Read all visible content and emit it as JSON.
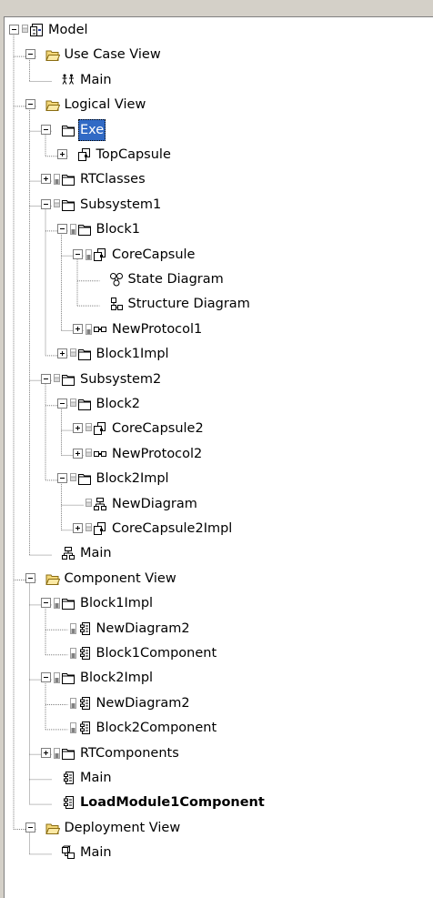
{
  "tree": [
    {
      "label": "Model",
      "level": 0,
      "icon": "model-icon",
      "control": "half",
      "state": "expanded"
    },
    {
      "label": "Use Case View",
      "level": 1,
      "icon": "folder-open-icon",
      "state": "expanded"
    },
    {
      "label": "Main",
      "level": 2,
      "icon": "use-case-diagram-icon",
      "state": "leaf"
    },
    {
      "label": "Logical View",
      "level": 1,
      "icon": "folder-open-icon",
      "state": "expanded"
    },
    {
      "label": "Exe",
      "level": 2,
      "icon": "package-icon",
      "state": "expanded",
      "selected": true
    },
    {
      "label": "TopCapsule",
      "level": 3,
      "icon": "capsule-icon",
      "state": "collapsed"
    },
    {
      "label": "RTClasses",
      "level": 2,
      "icon": "package-icon",
      "control": "locked",
      "state": "collapsed"
    },
    {
      "label": "Subsystem1",
      "level": 2,
      "icon": "package-icon",
      "control": "half",
      "state": "expanded"
    },
    {
      "label": "Block1",
      "level": 3,
      "icon": "package-icon",
      "control": "locked",
      "state": "expanded"
    },
    {
      "label": "CoreCapsule",
      "level": 4,
      "icon": "capsule-icon",
      "control": "locked",
      "state": "expanded"
    },
    {
      "label": "State Diagram",
      "level": 5,
      "icon": "state-diagram-icon",
      "state": "leaf"
    },
    {
      "label": "Structure Diagram",
      "level": 5,
      "icon": "structure-diagram-icon",
      "state": "leaf"
    },
    {
      "label": "NewProtocol1",
      "level": 4,
      "icon": "protocol-icon",
      "control": "locked",
      "state": "collapsed"
    },
    {
      "label": "Block1Impl",
      "level": 3,
      "icon": "package-icon",
      "control": "half",
      "state": "collapsed"
    },
    {
      "label": "Subsystem2",
      "level": 2,
      "icon": "package-icon",
      "control": "half",
      "state": "expanded"
    },
    {
      "label": "Block2",
      "level": 3,
      "icon": "package-icon",
      "control": "half",
      "state": "expanded"
    },
    {
      "label": "CoreCapsule2",
      "level": 4,
      "icon": "capsule-icon",
      "control": "half",
      "state": "collapsed"
    },
    {
      "label": "NewProtocol2",
      "level": 4,
      "icon": "protocol-icon",
      "control": "half",
      "state": "collapsed"
    },
    {
      "label": "Block2Impl",
      "level": 3,
      "icon": "package-icon",
      "control": "half",
      "state": "expanded"
    },
    {
      "label": "NewDiagram",
      "level": 4,
      "icon": "class-diagram-icon",
      "control": "half",
      "state": "leaf"
    },
    {
      "label": "CoreCapsule2Impl",
      "level": 4,
      "icon": "capsule-icon",
      "control": "half",
      "state": "collapsed"
    },
    {
      "label": "Main",
      "level": 2,
      "icon": "class-diagram-icon",
      "state": "leaf"
    },
    {
      "label": "Component View",
      "level": 1,
      "icon": "folder-open-icon",
      "state": "expanded"
    },
    {
      "label": "Block1Impl",
      "level": 2,
      "icon": "package-icon",
      "control": "locked",
      "state": "expanded"
    },
    {
      "label": "NewDiagram2",
      "level": 3,
      "icon": "component-icon",
      "control": "locked",
      "state": "leaf"
    },
    {
      "label": "Block1Component",
      "level": 3,
      "icon": "component-icon",
      "control": "locked",
      "state": "leaf"
    },
    {
      "label": "Block2Impl",
      "level": 2,
      "icon": "package-icon",
      "control": "locked",
      "state": "expanded"
    },
    {
      "label": "NewDiagram2",
      "level": 3,
      "icon": "component-icon",
      "control": "locked",
      "state": "leaf"
    },
    {
      "label": "Block2Component",
      "level": 3,
      "icon": "component-icon",
      "control": "locked",
      "state": "leaf"
    },
    {
      "label": "RTComponents",
      "level": 2,
      "icon": "package-icon",
      "control": "locked",
      "state": "collapsed"
    },
    {
      "label": "Main",
      "level": 2,
      "icon": "component-icon",
      "state": "leaf"
    },
    {
      "label": "LoadModule1Component",
      "level": 2,
      "icon": "component-icon",
      "state": "leaf",
      "bold": true
    },
    {
      "label": "Deployment View",
      "level": 1,
      "icon": "folder-open-icon",
      "state": "expanded"
    },
    {
      "label": "Main",
      "level": 2,
      "icon": "deployment-diagram-icon",
      "state": "leaf"
    }
  ]
}
